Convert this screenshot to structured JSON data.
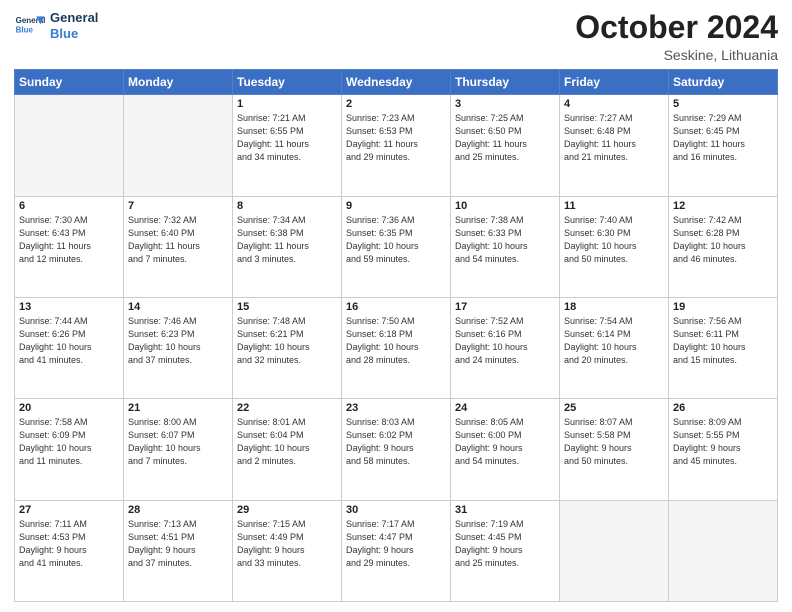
{
  "header": {
    "logo": {
      "line1": "General",
      "line2": "Blue"
    },
    "title": "October 2024",
    "subtitle": "Seskine, Lithuania"
  },
  "weekdays": [
    "Sunday",
    "Monday",
    "Tuesday",
    "Wednesday",
    "Thursday",
    "Friday",
    "Saturday"
  ],
  "weeks": [
    [
      {
        "day": null,
        "info": null
      },
      {
        "day": null,
        "info": null
      },
      {
        "day": "1",
        "info": "Sunrise: 7:21 AM\nSunset: 6:55 PM\nDaylight: 11 hours\nand 34 minutes."
      },
      {
        "day": "2",
        "info": "Sunrise: 7:23 AM\nSunset: 6:53 PM\nDaylight: 11 hours\nand 29 minutes."
      },
      {
        "day": "3",
        "info": "Sunrise: 7:25 AM\nSunset: 6:50 PM\nDaylight: 11 hours\nand 25 minutes."
      },
      {
        "day": "4",
        "info": "Sunrise: 7:27 AM\nSunset: 6:48 PM\nDaylight: 11 hours\nand 21 minutes."
      },
      {
        "day": "5",
        "info": "Sunrise: 7:29 AM\nSunset: 6:45 PM\nDaylight: 11 hours\nand 16 minutes."
      }
    ],
    [
      {
        "day": "6",
        "info": "Sunrise: 7:30 AM\nSunset: 6:43 PM\nDaylight: 11 hours\nand 12 minutes."
      },
      {
        "day": "7",
        "info": "Sunrise: 7:32 AM\nSunset: 6:40 PM\nDaylight: 11 hours\nand 7 minutes."
      },
      {
        "day": "8",
        "info": "Sunrise: 7:34 AM\nSunset: 6:38 PM\nDaylight: 11 hours\nand 3 minutes."
      },
      {
        "day": "9",
        "info": "Sunrise: 7:36 AM\nSunset: 6:35 PM\nDaylight: 10 hours\nand 59 minutes."
      },
      {
        "day": "10",
        "info": "Sunrise: 7:38 AM\nSunset: 6:33 PM\nDaylight: 10 hours\nand 54 minutes."
      },
      {
        "day": "11",
        "info": "Sunrise: 7:40 AM\nSunset: 6:30 PM\nDaylight: 10 hours\nand 50 minutes."
      },
      {
        "day": "12",
        "info": "Sunrise: 7:42 AM\nSunset: 6:28 PM\nDaylight: 10 hours\nand 46 minutes."
      }
    ],
    [
      {
        "day": "13",
        "info": "Sunrise: 7:44 AM\nSunset: 6:26 PM\nDaylight: 10 hours\nand 41 minutes."
      },
      {
        "day": "14",
        "info": "Sunrise: 7:46 AM\nSunset: 6:23 PM\nDaylight: 10 hours\nand 37 minutes."
      },
      {
        "day": "15",
        "info": "Sunrise: 7:48 AM\nSunset: 6:21 PM\nDaylight: 10 hours\nand 32 minutes."
      },
      {
        "day": "16",
        "info": "Sunrise: 7:50 AM\nSunset: 6:18 PM\nDaylight: 10 hours\nand 28 minutes."
      },
      {
        "day": "17",
        "info": "Sunrise: 7:52 AM\nSunset: 6:16 PM\nDaylight: 10 hours\nand 24 minutes."
      },
      {
        "day": "18",
        "info": "Sunrise: 7:54 AM\nSunset: 6:14 PM\nDaylight: 10 hours\nand 20 minutes."
      },
      {
        "day": "19",
        "info": "Sunrise: 7:56 AM\nSunset: 6:11 PM\nDaylight: 10 hours\nand 15 minutes."
      }
    ],
    [
      {
        "day": "20",
        "info": "Sunrise: 7:58 AM\nSunset: 6:09 PM\nDaylight: 10 hours\nand 11 minutes."
      },
      {
        "day": "21",
        "info": "Sunrise: 8:00 AM\nSunset: 6:07 PM\nDaylight: 10 hours\nand 7 minutes."
      },
      {
        "day": "22",
        "info": "Sunrise: 8:01 AM\nSunset: 6:04 PM\nDaylight: 10 hours\nand 2 minutes."
      },
      {
        "day": "23",
        "info": "Sunrise: 8:03 AM\nSunset: 6:02 PM\nDaylight: 9 hours\nand 58 minutes."
      },
      {
        "day": "24",
        "info": "Sunrise: 8:05 AM\nSunset: 6:00 PM\nDaylight: 9 hours\nand 54 minutes."
      },
      {
        "day": "25",
        "info": "Sunrise: 8:07 AM\nSunset: 5:58 PM\nDaylight: 9 hours\nand 50 minutes."
      },
      {
        "day": "26",
        "info": "Sunrise: 8:09 AM\nSunset: 5:55 PM\nDaylight: 9 hours\nand 45 minutes."
      }
    ],
    [
      {
        "day": "27",
        "info": "Sunrise: 7:11 AM\nSunset: 4:53 PM\nDaylight: 9 hours\nand 41 minutes."
      },
      {
        "day": "28",
        "info": "Sunrise: 7:13 AM\nSunset: 4:51 PM\nDaylight: 9 hours\nand 37 minutes."
      },
      {
        "day": "29",
        "info": "Sunrise: 7:15 AM\nSunset: 4:49 PM\nDaylight: 9 hours\nand 33 minutes."
      },
      {
        "day": "30",
        "info": "Sunrise: 7:17 AM\nSunset: 4:47 PM\nDaylight: 9 hours\nand 29 minutes."
      },
      {
        "day": "31",
        "info": "Sunrise: 7:19 AM\nSunset: 4:45 PM\nDaylight: 9 hours\nand 25 minutes."
      },
      {
        "day": null,
        "info": null
      },
      {
        "day": null,
        "info": null
      }
    ]
  ]
}
